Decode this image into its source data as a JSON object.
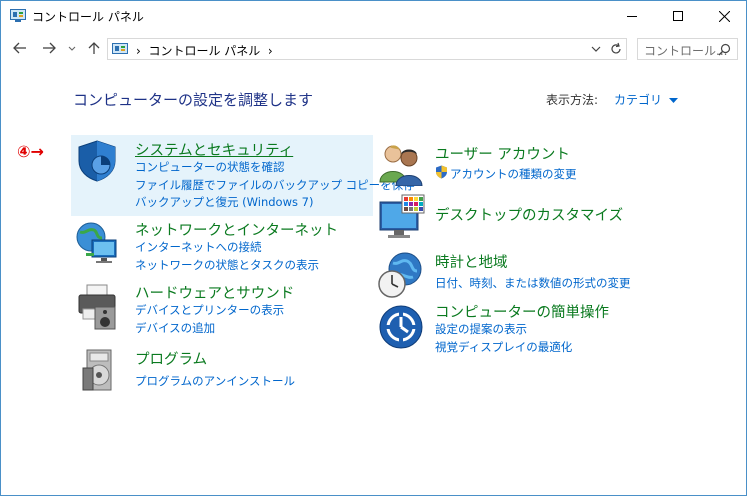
{
  "window": {
    "title": "コントロール パネル"
  },
  "nav": {
    "back_icon": "back-arrow-icon",
    "forward_icon": "forward-arrow-icon",
    "up_icon": "up-arrow-icon"
  },
  "address": {
    "separator": "›",
    "path": "コントロール パネル",
    "trailing_separator": "›"
  },
  "search": {
    "placeholder": "コントロール..."
  },
  "main": {
    "heading": "コンピューターの設定を調整します",
    "view_by_label": "表示方法:",
    "view_by_value": "カテゴリ"
  },
  "annotation": {
    "label": "④→",
    "color": "#e00000"
  },
  "categories": [
    {
      "title": "システムとセキュリティ",
      "links": [
        "コンピューターの状態を確認",
        "ファイル履歴でファイルのバックアップ コピーを保存",
        "バックアップと復元 (Windows 7)"
      ]
    },
    {
      "title": "ネットワークとインターネット",
      "links": [
        "インターネットへの接続",
        "ネットワークの状態とタスクの表示"
      ]
    },
    {
      "title": "ハードウェアとサウンド",
      "links": [
        "デバイスとプリンターの表示",
        "デバイスの追加"
      ]
    },
    {
      "title": "プログラム",
      "links": [
        "プログラムのアンインストール"
      ]
    },
    {
      "title": "ユーザー アカウント",
      "links": [
        "アカウントの種類の変更"
      ]
    },
    {
      "title": "デスクトップのカスタマイズ",
      "links": []
    },
    {
      "title": "時計と地域",
      "links": [
        "日付、時刻、または数値の形式の変更"
      ]
    },
    {
      "title": "コンピューターの簡単操作",
      "links": [
        "設定の提案の表示",
        "視覚ディスプレイの最適化"
      ]
    }
  ],
  "colors": {
    "title_green": "#0a7a1f",
    "link_blue": "#0066cc",
    "heading_blue": "#1e3287",
    "highlight": "#e5f3fb"
  }
}
